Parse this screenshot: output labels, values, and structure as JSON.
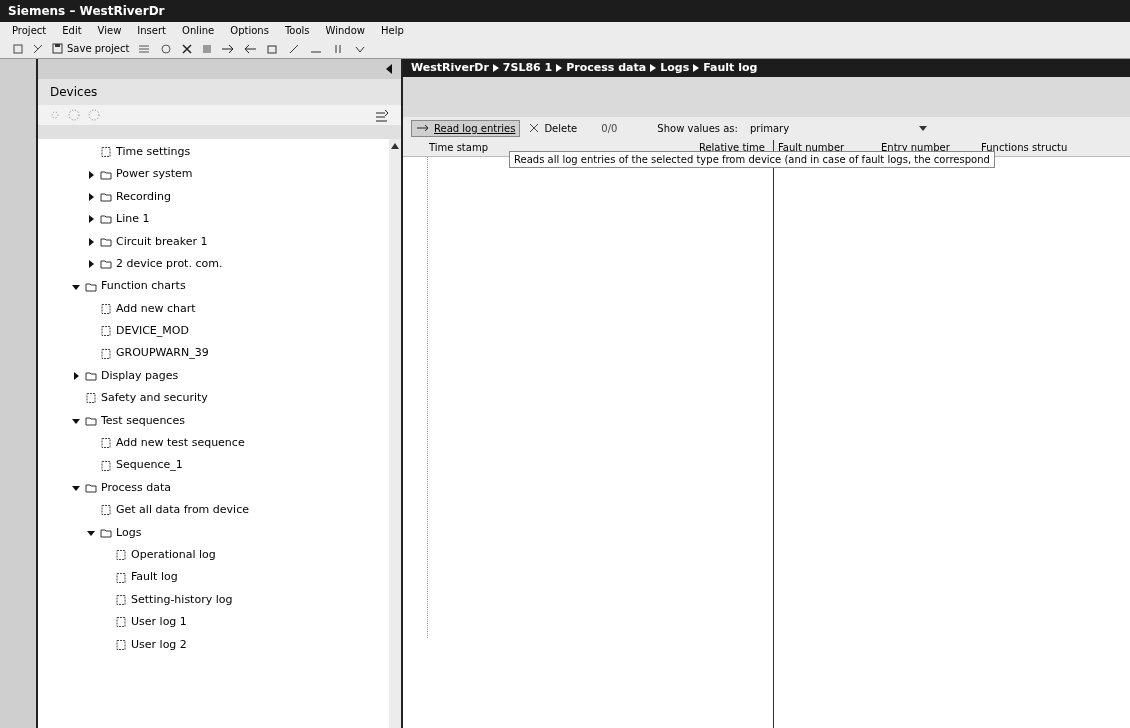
{
  "window": {
    "title": "Siemens – WestRiverDr"
  },
  "menu": [
    "Project",
    "Edit",
    "View",
    "Insert",
    "Online",
    "Options",
    "Tools",
    "Window",
    "Help"
  ],
  "toolbar": {
    "save_label": "Save project"
  },
  "devices_panel": {
    "title": "Devices",
    "tree": [
      {
        "children": [
          {
            "label": "Time settings"
          },
          {
            "label": "Power system",
            "expanded": false
          },
          {
            "label": "Recording",
            "expanded": false
          },
          {
            "label": "Line 1",
            "expanded": false
          },
          {
            "label": "Circuit breaker 1",
            "expanded": false
          },
          {
            "label": "2 device prot. com.",
            "expanded": false
          }
        ]
      },
      {
        "label": "Function charts",
        "expanded": true,
        "children": [
          {
            "label": "Add new chart"
          },
          {
            "label": "DEVICE_MOD"
          },
          {
            "label": "GROUPWARN_39"
          }
        ]
      },
      {
        "label": "Display pages",
        "expanded": false
      },
      {
        "label": "Safety and security"
      },
      {
        "label": "Test sequences",
        "expanded": true,
        "children": [
          {
            "label": "Add new test sequence"
          },
          {
            "label": "Sequence_1"
          }
        ]
      },
      {
        "label": "Process data",
        "expanded": true,
        "children": [
          {
            "label": "Get all data from device"
          },
          {
            "label": "Logs",
            "expanded": true,
            "children": [
              {
                "label": "Operational log"
              },
              {
                "label": "Fault log"
              },
              {
                "label": "Setting-history log"
              },
              {
                "label": "User log 1"
              },
              {
                "label": "User log 2"
              }
            ]
          }
        ]
      }
    ]
  },
  "breadcrumb": [
    "WestRiverDr",
    "7SL86 1",
    "Process data",
    "Logs",
    "Fault log"
  ],
  "log_toolbar": {
    "read_button": "Read log entries",
    "delete_button": "Delete",
    "count": "0/0",
    "show_values_label": "Show values as:",
    "show_values_value": "primary"
  },
  "table": {
    "columns": [
      "Time stamp",
      "Relative time",
      "Fault number",
      "Entry number",
      "Functions structu"
    ]
  },
  "tooltip": "Reads all log entries of the selected type from device (and in case of fault logs, the correspond"
}
